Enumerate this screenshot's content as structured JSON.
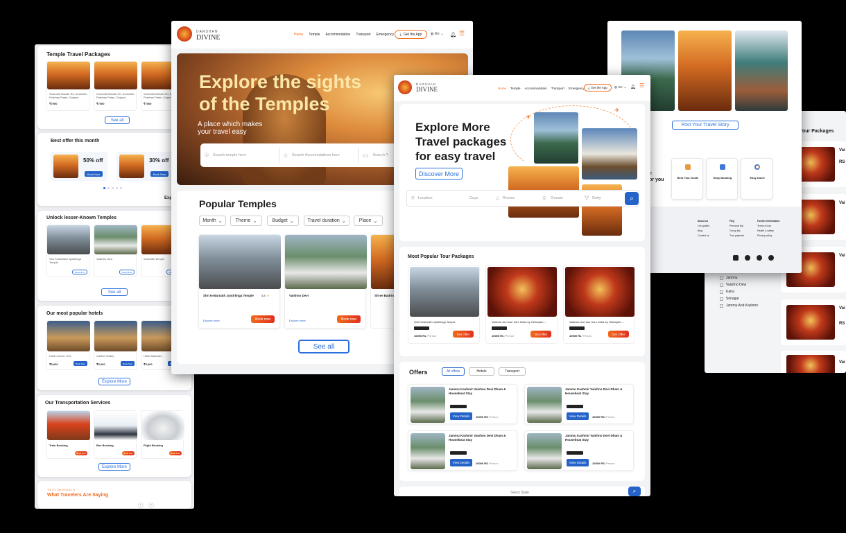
{
  "brand": {
    "name_top": "DARSHAN",
    "name_main": "DIVINE"
  },
  "nav": {
    "home": "Home",
    "temple": "Temple",
    "accommodation": "Accommodation",
    "transport": "Transport",
    "emergency": "Emergency",
    "get_app": "Get the App",
    "lang": "En"
  },
  "left_page": {
    "packages_title": "Temple Travel Packages",
    "package_cards": [
      {
        "name": "Somnath Mandir Rd, Somnath, Prabhas Patan, Gujarat",
        "price": "₹7000"
      },
      {
        "name": "Somnath Mandir Rd, Somnath, Prabhas Patan, Gujarat",
        "price": "₹7000"
      },
      {
        "name": "Somnath Mandir Rd, Somnath, Prabhas Patan, Gujarat",
        "price": "₹7000"
      }
    ],
    "see_all": "See all",
    "best_offer_title": "Best offer this month",
    "offers": [
      {
        "discount": "50% off",
        "cta": "Book Now"
      },
      {
        "discount": "30% off",
        "cta": "Book Now"
      }
    ],
    "explore_cut": "Explo",
    "unlock_title": "Unlock lesser-Known Temples",
    "unlock_cards": [
      {
        "name": "Shri Kedarnath Jyotirlinga Temple",
        "cta": "Read More"
      },
      {
        "name": "Vaishno Devi",
        "cta": "Read More"
      },
      {
        "name": "Somnath Temple",
        "cta": "Read More"
      }
    ],
    "see_all_2": "See all",
    "hotels_title": "Our most popular hotels",
    "hotel_cards": [
      {
        "name": "Hotel Lemon Tree",
        "price": "₹5,000",
        "cta": "Book Now"
      },
      {
        "name": "Carlton Suites",
        "price": "₹5,000",
        "cta": "Book Now"
      },
      {
        "name": "Hotel Mahadev",
        "price": "₹5,000",
        "cta": "Book Now"
      }
    ],
    "explore_more": "Explore More",
    "transport_title": "Our Transportation Services",
    "transport_cards": [
      {
        "name": "Train Booking",
        "cta": "Book Now"
      },
      {
        "name": "Bus Booking",
        "cta": "Book Now"
      },
      {
        "name": "Flight Booking",
        "cta": "Book Now"
      }
    ],
    "explore_more_2": "Explore More",
    "testimonials_kicker": "TESTIMONIALS",
    "testimonials_title": "What Travelers Are Saying"
  },
  "hero_page": {
    "headline_1": "Explore the sights",
    "headline_2": "of the Temples",
    "sub_1": "A place which makes",
    "sub_2": "your travel easy",
    "search_temple": "Search temple here",
    "search_accom": "Search Accomodations here",
    "search_t": "Search T",
    "popular_title": "Popular Temples",
    "filters": [
      "Month",
      "Theme",
      "Budget",
      "Travel duration",
      "Place"
    ],
    "temple_cards": [
      {
        "name": "Shri Kedarnath Jyotirlinga Temple",
        "rating": "4.8",
        "cta": "Book now",
        "more": "Explore more"
      },
      {
        "name": "Vaishno Devi",
        "cta": "Book now",
        "more": "Explore more"
      },
      {
        "name": "Shree Badrin"
      }
    ],
    "see_all": "See all"
  },
  "center_page": {
    "headline_1": "Explore More",
    "headline_2": "Travel packages",
    "headline_3": "for easy travel",
    "discover": "Discover More",
    "search": {
      "location": "Location",
      "days": "Days",
      "rooms": "Rooms",
      "guests": "Guests",
      "deity": "Deity"
    },
    "tour_title": "Most Popular Tour Packages",
    "tour_cards": [
      {
        "name": "Shri Kedarnath Jyotirlinga Temple",
        "price": "10000 Rs",
        "per": "/Person",
        "cta": "Get Offer"
      },
      {
        "name": "Vaishno devi tour from Katra by Helicopter....",
        "price": "10000 Rs",
        "per": "/Person",
        "cta": "Get Offer"
      },
      {
        "name": "Vaishno devi tour from Katra by Helicopter....",
        "price": "10000 Rs",
        "per": "/Person",
        "cta": "Get Offer"
      }
    ],
    "offers_title": "Offers",
    "offer_tabs": [
      "All offers",
      "Hotels",
      "Transport"
    ],
    "offer_cards": [
      {
        "title": "Jammu Kashmir Vaishno Devi Dham & Houseboat Stay",
        "cta": "View Details",
        "price": "10000 RS",
        "per": "/Person"
      },
      {
        "title": "Jammu Kashmir Vaishno Devi Dham & Houseboat Stay",
        "cta": "View Details",
        "price": "10000 RS",
        "per": "/Person"
      },
      {
        "title": "Jammu Kashmir Vaishno Devi Dham & Houseboat Stay",
        "cta": "View Details",
        "price": "10000 RS",
        "per": "/Person"
      },
      {
        "title": "Jammu Kashmir Vaishno Devi Dham & Houseboat Stay",
        "cta": "View Details",
        "price": "10000 RS",
        "per": "/Person"
      }
    ],
    "select_state": "Select State"
  },
  "right_top": {
    "post_story": "Post Your Travel Story",
    "features": [
      {
        "title": "Best Tour Guide"
      },
      {
        "title": "Easy Booking"
      },
      {
        "title": "Easy travel"
      }
    ],
    "e_text": "e",
    "for_you": "or you",
    "footer_cols": [
      {
        "title": "About us",
        "items": [
          "Our guides",
          "Blog",
          "Contact us"
        ]
      },
      {
        "title": "FAQ",
        "items": [
          "Personal trip",
          "Group trip",
          "Tour payment"
        ]
      },
      {
        "title": "Further information",
        "items": [
          "Terms of use",
          "Health & safety",
          "Privacy policy"
        ]
      }
    ]
  },
  "right_bottom": {
    "title": "no Devi Tour Packages",
    "filters": [
      "Jammu",
      "Vaishno Devi",
      "Katra",
      "Srinagar",
      "Jammu And Kashmir"
    ],
    "item_labels": [
      "Vai",
      "Vai",
      "Vai",
      "Vai",
      "Vai"
    ],
    "price": "RS"
  },
  "colors": {
    "accent_orange": "#f26a1b",
    "accent_blue": "#2563c9",
    "brand_gold": "#c98a2b"
  }
}
